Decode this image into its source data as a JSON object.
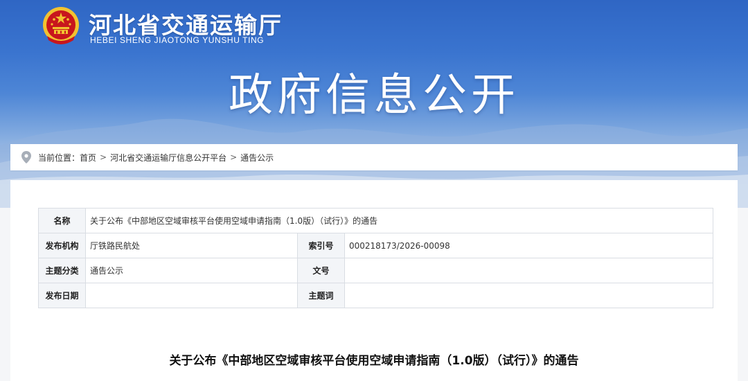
{
  "header": {
    "org_name": "河北省交通运输厅",
    "org_pinyin": "HEBEI SHENG JIAOTONG YUNSHU TING",
    "section_title": "政府信息公开",
    "emblem_icon": "national-emblem-icon"
  },
  "breadcrumb": {
    "icon": "location-pin-icon",
    "prefix": "当前位置：",
    "items": [
      "首页",
      "河北省交通运输厅信息公开平台",
      "通告公示"
    ],
    "separator": ">"
  },
  "info_table": {
    "rows": [
      {
        "label": "名称",
        "value": "关于公布《中部地区空域审核平台使用空域申请指南（1.0版）（试行）》的通告"
      },
      {
        "label": "发布机构",
        "value": "厅铁路民航处",
        "label2": "索引号",
        "value2": "000218173/2026-00098"
      },
      {
        "label": "主题分类",
        "value": "通告公示",
        "label2": "文号",
        "value2": ""
      },
      {
        "label": "发布日期",
        "value": "",
        "label2": "主题词",
        "value2": ""
      }
    ]
  },
  "document": {
    "title": "关于公布《中部地区空域审核平台使用空域申请指南（1.0版）（试行）》的通告"
  },
  "colors": {
    "banner_top": "#2f66c4",
    "banner_bottom": "#d5e1f0",
    "emblem_red": "#c8161d",
    "emblem_gold": "#f2c230"
  }
}
